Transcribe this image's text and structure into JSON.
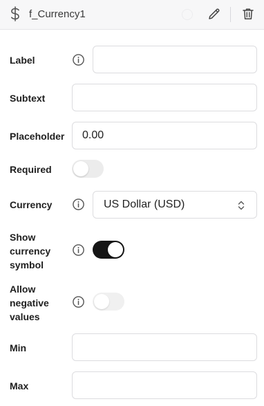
{
  "header": {
    "icon": "dollar-icon",
    "title": "f_Currency1",
    "actions": [
      "pencil-icon",
      "trash-icon"
    ]
  },
  "fields": {
    "label": {
      "label": "Label",
      "value": ""
    },
    "subtext": {
      "label": "Subtext",
      "value": ""
    },
    "placeholder": {
      "label": "Placeholder",
      "value": "0.00"
    },
    "required": {
      "label": "Required",
      "checked": false
    },
    "currency": {
      "label": "Currency",
      "selected": "US Dollar (USD)"
    },
    "show_currency_symbol": {
      "label_line1": "Show",
      "label_line2": "currency",
      "label_line3": "symbol",
      "checked": true
    },
    "allow_negative_values": {
      "label_line1": "Allow",
      "label_line2": "negative",
      "label_line3": "values",
      "checked": false
    },
    "min": {
      "label": "Min",
      "value": ""
    },
    "max": {
      "label": "Max",
      "value": ""
    }
  },
  "colors": {
    "toggle_on": "#151515",
    "toggle_off": "#ececec",
    "header_bg": "#f7f7f8",
    "border": "#dcdcdf"
  }
}
